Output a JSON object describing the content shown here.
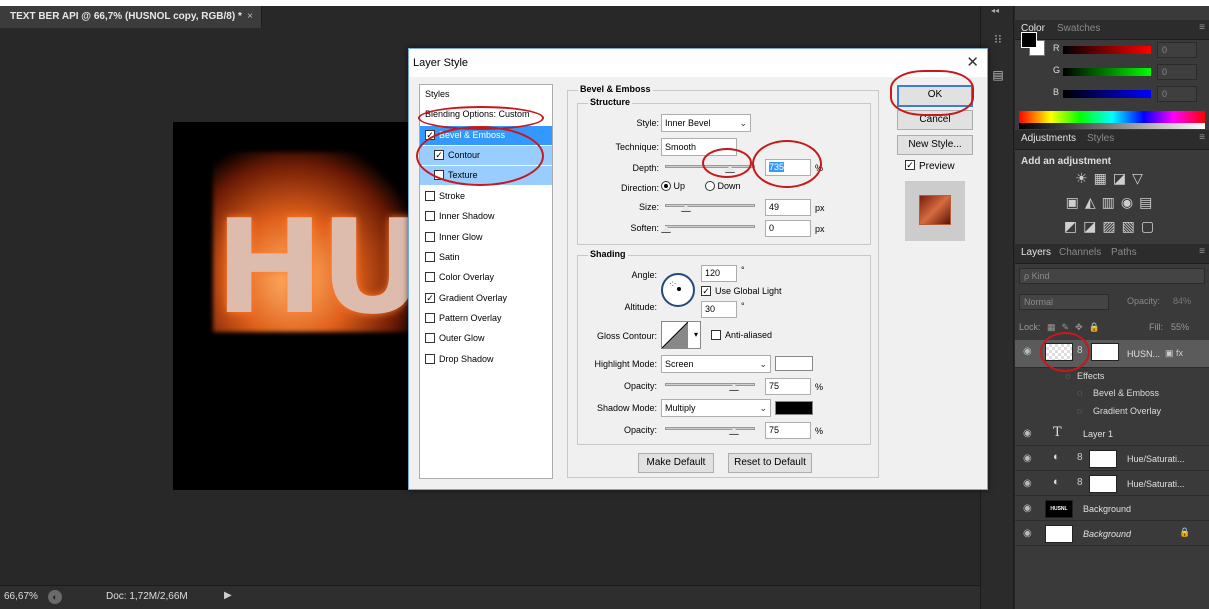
{
  "document_tab": {
    "title": "TEXT BER API @ 66,7% (HUSNOL copy, RGB/8) *",
    "close": "×"
  },
  "artwork": {
    "text": "HUS"
  },
  "status_bar": {
    "zoom": "66,67%",
    "doc_info": "Doc: 1,72M/2,66M",
    "arrow": "▶"
  },
  "color_panel": {
    "tabs": [
      "Color",
      "Swatches"
    ],
    "sliders": [
      {
        "label": "R",
        "value": "0"
      },
      {
        "label": "G",
        "value": "0"
      },
      {
        "label": "B",
        "value": "0"
      }
    ]
  },
  "adjustments_panel": {
    "tabs": [
      "Adjustments",
      "Styles"
    ],
    "title": "Add an adjustment"
  },
  "layers_panel": {
    "tabs": [
      "Layers",
      "Channels",
      "Paths"
    ],
    "kind": "ρ Kind",
    "blend_mode": "Normal",
    "opacity_label": "Opacity:",
    "opacity_value": "84%",
    "lock_label": "Lock:",
    "fill_label": "Fill:",
    "fill_value": "55%",
    "layers": [
      {
        "name": "HUSN..."
      },
      {
        "name": "Effects"
      },
      {
        "name": "Bevel & Emboss"
      },
      {
        "name": "Gradient Overlay"
      },
      {
        "name": "Layer 1"
      },
      {
        "name": "Hue/Saturati..."
      },
      {
        "name": "Hue/Saturati..."
      },
      {
        "name": "Background"
      },
      {
        "name": "Background"
      }
    ],
    "bg_thumb_text": "HUSNL"
  },
  "dialog": {
    "title": "Layer Style",
    "close": "✕",
    "styles_list": [
      {
        "label": "Styles"
      },
      {
        "label": "Blending Options: Custom"
      },
      {
        "label": "Bevel & Emboss",
        "checked": true
      },
      {
        "label": "Contour",
        "checked": true
      },
      {
        "label": "Texture",
        "checked": false
      },
      {
        "label": "Stroke",
        "checked": false
      },
      {
        "label": "Inner Shadow",
        "checked": false
      },
      {
        "label": "Inner Glow",
        "checked": false
      },
      {
        "label": "Satin",
        "checked": false
      },
      {
        "label": "Color Overlay",
        "checked": false
      },
      {
        "label": "Gradient Overlay",
        "checked": true
      },
      {
        "label": "Pattern Overlay",
        "checked": false
      },
      {
        "label": "Outer Glow",
        "checked": false
      },
      {
        "label": "Drop Shadow",
        "checked": false
      }
    ],
    "section_title": "Bevel & Emboss",
    "structure": {
      "title": "Structure",
      "style_label": "Style:",
      "style_value": "Inner Bevel",
      "technique_label": "Technique:",
      "technique_value": "Smooth",
      "depth_label": "Depth:",
      "depth_value": "735",
      "depth_unit": "%",
      "direction_label": "Direction:",
      "direction_up": "Up",
      "direction_down": "Down",
      "size_label": "Size:",
      "size_value": "49",
      "size_unit": "px",
      "soften_label": "Soften:",
      "soften_value": "0",
      "soften_unit": "px"
    },
    "shading": {
      "title": "Shading",
      "angle_label": "Angle:",
      "angle_value": "120",
      "angle_unit": "°",
      "global_light": "Use Global Light",
      "altitude_label": "Altitude:",
      "altitude_value": "30",
      "altitude_unit": "°",
      "gloss_label": "Gloss Contour:",
      "anti_aliased": "Anti-aliased",
      "highlight_label": "Highlight Mode:",
      "highlight_value": "Screen",
      "highlight_opacity_label": "Opacity:",
      "highlight_opacity_value": "75",
      "shadow_label": "Shadow Mode:",
      "shadow_value": "Multiply",
      "shadow_opacity_label": "Opacity:",
      "shadow_opacity_value": "75",
      "pct": "%"
    },
    "buttons": {
      "make_default": "Make Default",
      "reset_default": "Reset to Default",
      "ok": "OK",
      "cancel": "Cancel",
      "new_style": "New Style...",
      "preview": "Preview"
    }
  }
}
